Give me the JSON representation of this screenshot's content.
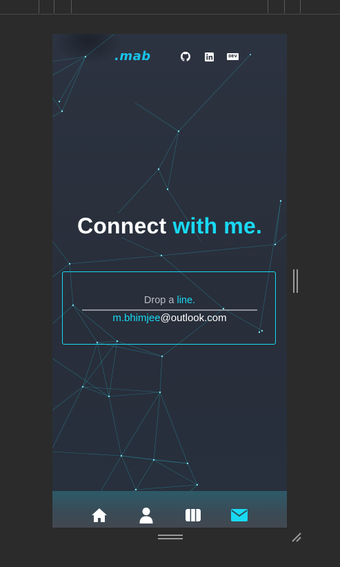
{
  "brand": {
    "logo_text": ".mab",
    "accent_color": "#19c3ea"
  },
  "social_links": [
    {
      "name": "github",
      "icon": "github-icon"
    },
    {
      "name": "linkedin",
      "icon": "linkedin-icon"
    },
    {
      "name": "dev",
      "icon": "dev-icon",
      "label": "DEV"
    }
  ],
  "hero": {
    "title_part1": "Connect",
    "title_part2": "with me."
  },
  "contact": {
    "prompt": "Drop a",
    "prompt_accent": "line.",
    "email_user": "m.bhimjee",
    "email_domain": "@outlook.com"
  },
  "nav": {
    "items": [
      {
        "name": "home",
        "icon": "home-icon",
        "active": false
      },
      {
        "name": "about",
        "icon": "user-icon",
        "active": false
      },
      {
        "name": "projects",
        "icon": "columns-icon",
        "active": false
      },
      {
        "name": "contact",
        "icon": "mail-icon",
        "active": true
      }
    ],
    "active_color": "#19d9f3",
    "inactive_color": "#ffffff"
  },
  "colors": {
    "accent": "#19d9f3",
    "background": "#2a303c"
  }
}
